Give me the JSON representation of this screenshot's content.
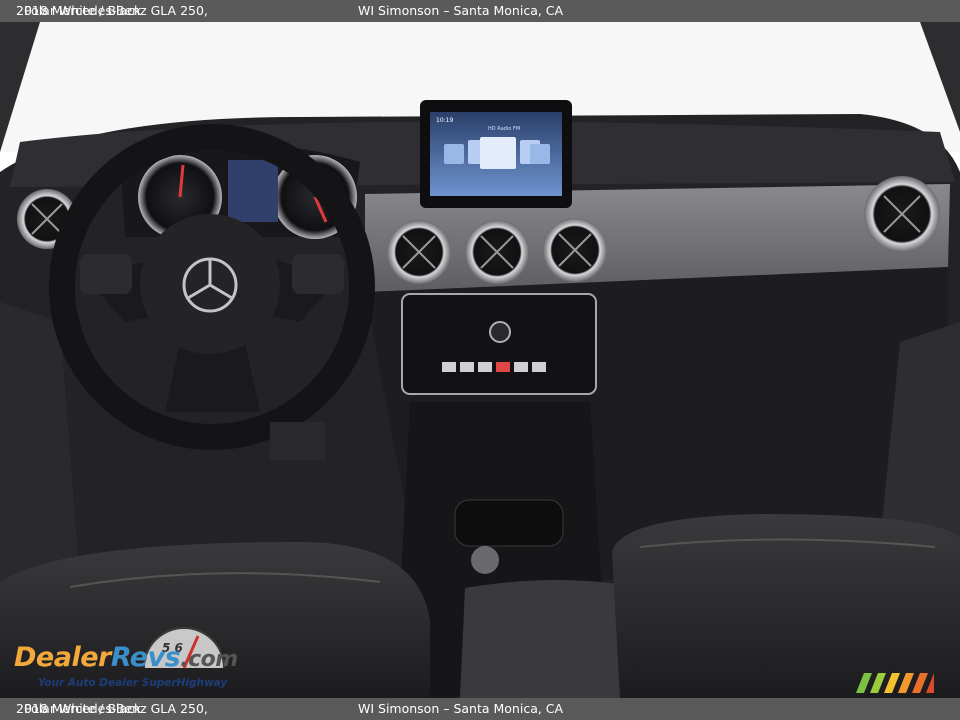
{
  "caption": {
    "title": "2018 Mercedes-Benz GLA 250,",
    "color": "Polar White / Black",
    "dealer": "WI Simonson – Santa Monica, CA"
  },
  "watermark": {
    "brand_part1": "Dealer",
    "brand_part2": "Revs",
    "brand_part3": ".com",
    "tagline": "Your Auto Dealer SuperHighway",
    "gauge_digits": "5 6"
  },
  "photo": {
    "subject": "interior dashboard",
    "screen_time": "10:19",
    "screen_station": "HD Radio FM"
  },
  "colors": {
    "caption_bg": "#5a5a5a",
    "brand_orange": "#f2a83a",
    "brand_blue": "#3a8fc9",
    "tagline_navy": "#1d3d7a"
  }
}
